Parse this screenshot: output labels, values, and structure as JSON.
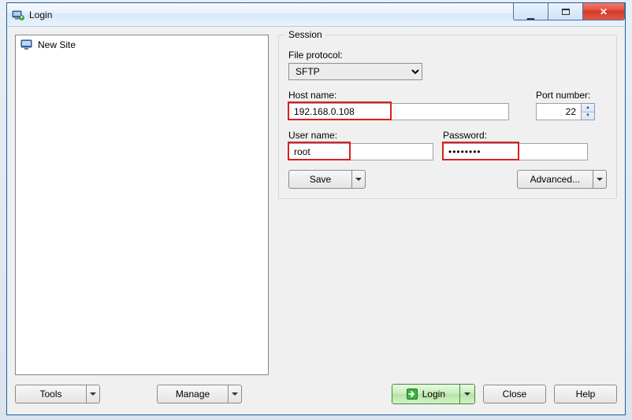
{
  "window": {
    "title": "Login"
  },
  "sites": {
    "list": [
      {
        "label": "New Site"
      }
    ]
  },
  "session": {
    "group_label": "Session",
    "protocol_label": "File protocol:",
    "protocol_value": "SFTP",
    "host_label": "Host name:",
    "host_value": "192.168.0.108",
    "port_label": "Port number:",
    "port_value": "22",
    "user_label": "User name:",
    "user_value": "root",
    "password_label": "Password:",
    "password_value": "••••••••",
    "save_label": "Save",
    "advanced_label": "Advanced..."
  },
  "buttons": {
    "tools": "Tools",
    "manage": "Manage",
    "login": "Login",
    "close": "Close",
    "help": "Help"
  },
  "icons": {
    "app": "app-icon",
    "min": "minimize-icon",
    "max": "maximize-icon",
    "close": "close-icon",
    "site": "monitor-icon",
    "login": "login-arrow-icon"
  }
}
